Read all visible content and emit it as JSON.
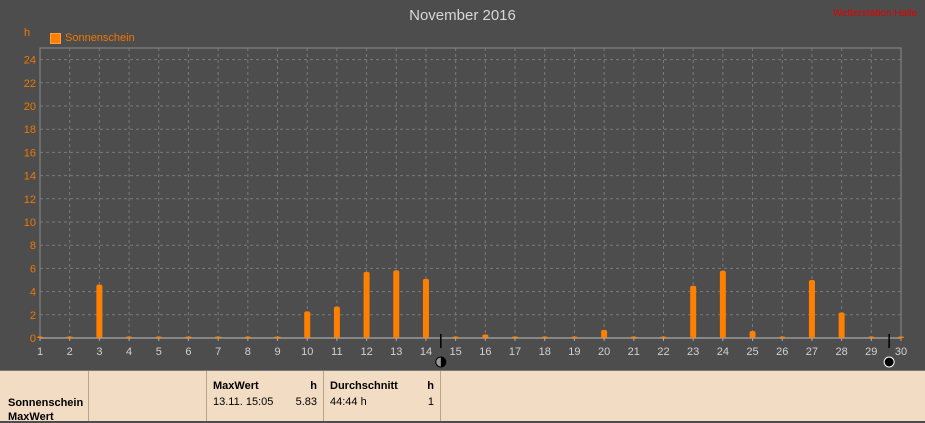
{
  "title": "November 2016",
  "link": "Wetterstation Halle",
  "unit_label": "h",
  "legend_label": "Sonnenschein",
  "colors": {
    "series": "#ff8000",
    "background": "#4d4d4d",
    "grid": "#7a7a7a",
    "axis_text": "#f07800"
  },
  "icons": [
    "moon-phase-half-icon",
    "moon-phase-new-icon"
  ],
  "table": {
    "row_label_1": "Sonnenschein",
    "row_label_2": "MaxWert",
    "max_header": "MaxWert",
    "max_unit": "h",
    "max_date": "13.11.  15:05",
    "max_value": "5.83",
    "avg_header": "Durchschnitt",
    "avg_unit": "h",
    "avg_value": "44:44 h",
    "avg_count": "1"
  },
  "chart_data": {
    "type": "bar",
    "title": "November 2016",
    "ylabel": "h",
    "ylim": [
      0,
      25
    ],
    "yticks": [
      0,
      2,
      4,
      6,
      8,
      10,
      12,
      14,
      16,
      18,
      20,
      22,
      24
    ],
    "categories": [
      "1",
      "2",
      "3",
      "4",
      "5",
      "6",
      "7",
      "8",
      "9",
      "10",
      "11",
      "12",
      "13",
      "14",
      "15",
      "16",
      "17",
      "18",
      "19",
      "20",
      "21",
      "22",
      "23",
      "24",
      "25",
      "26",
      "27",
      "28",
      "29",
      "30"
    ],
    "series": [
      {
        "name": "Sonnenschein",
        "values": [
          0,
          0,
          4.6,
          0,
          0,
          0,
          0,
          0,
          0,
          2.3,
          2.7,
          5.7,
          5.83,
          5.1,
          0,
          0.3,
          0,
          0,
          0,
          0.7,
          0,
          0,
          4.5,
          5.8,
          0.6,
          0,
          5.0,
          2.2,
          0,
          0
        ]
      }
    ],
    "grid": true,
    "legend": "top-left"
  }
}
